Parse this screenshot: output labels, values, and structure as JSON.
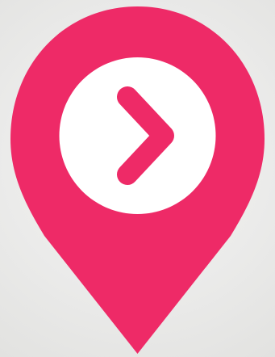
{
  "icon": {
    "name": "location-pin-icon",
    "inner_icon": "chevron-right-icon"
  },
  "colors": {
    "background": "#ebebea",
    "pin": "#ee2a67",
    "circle": "#ffffff",
    "chevron": "#ee2a67"
  }
}
